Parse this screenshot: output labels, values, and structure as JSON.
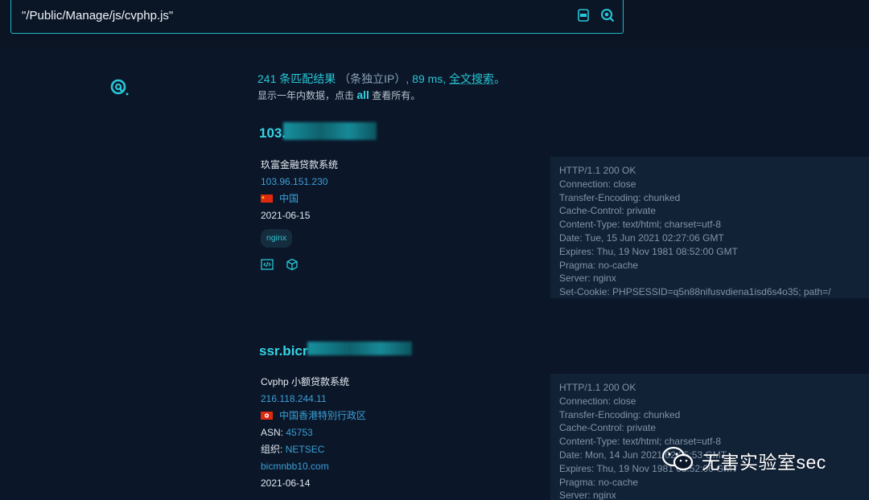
{
  "search": {
    "query": "\"/Public/Manage/js/cvphp.js\""
  },
  "summary": {
    "count": "241",
    "results_label": "条匹配结果",
    "unique_ip": "（条独立IP）,",
    "time": "89 ms",
    "sep": ",",
    "fulltext_link": "全文搜索",
    "end": "。",
    "sub_prefix": "显示一年内数据，点击",
    "sub_all": "all",
    "sub_suffix": "查看所有。"
  },
  "results": [
    {
      "host": "103.",
      "title": "玖富金融贷款系统",
      "ip": "103.96.151.230",
      "location": "中国",
      "date": "2021-06-15",
      "tag": "nginx",
      "headers": [
        "HTTP/1.1 200 OK",
        "Connection: close",
        "Transfer-Encoding: chunked",
        "Cache-Control: private",
        "Content-Type: text/html; charset=utf-8",
        "Date: Tue, 15 Jun 2021 02:27:06 GMT",
        "Expires: Thu, 19 Nov 1981 08:52:00 GMT",
        "Pragma: no-cache",
        "Server: nginx",
        "Set-Cookie: PHPSESSID=q5n88nifusvdiena1isd6s4o35; path=/"
      ]
    },
    {
      "host": "ssr.bicr",
      "title": "Cvphp 小额贷款系统",
      "ip": "216.118.244.11",
      "location": "中国香港特别行政区",
      "asn_label": "ASN:",
      "asn": "45753",
      "org_label": "组织:",
      "org": "NETSEC",
      "domain": "bicmnbb10.com",
      "date": "2021-06-14",
      "headers": [
        "HTTP/1.1 200 OK",
        "Connection: close",
        "Transfer-Encoding: chunked",
        "Cache-Control: private",
        "Content-Type: text/html; charset=utf-8",
        "Date: Mon, 14 Jun 2021 02:25:53 GMT",
        "Expires: Thu, 19 Nov 1981 08:52:00 GMT",
        "Pragma: no-cache",
        "Server: nginx"
      ]
    }
  ],
  "watermark": {
    "text": "无害实验室sec"
  },
  "colors": {
    "accent": "#27c7d6",
    "background": "#0b1628",
    "link": "#3aa0d8",
    "panel": "#122236"
  }
}
